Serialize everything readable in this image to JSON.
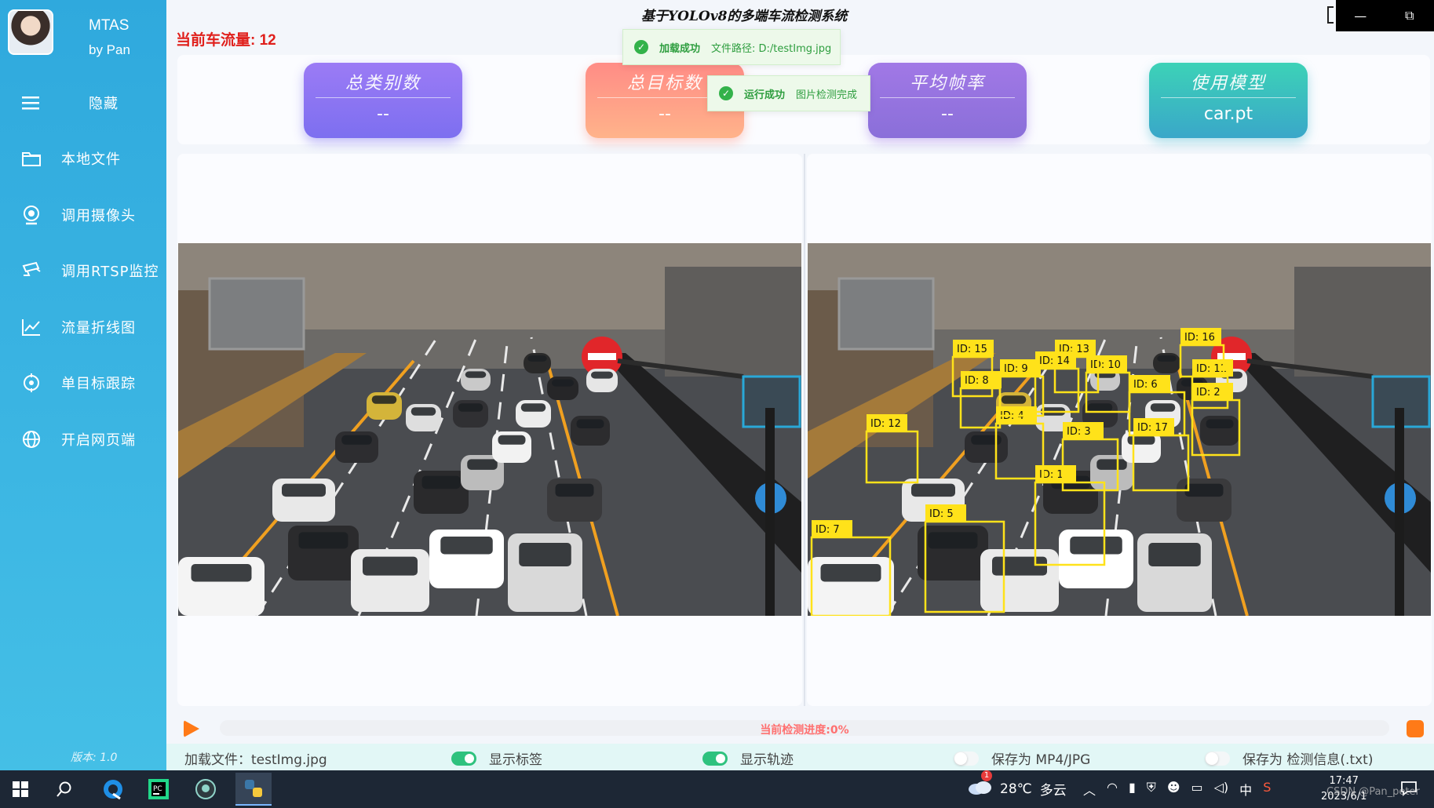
{
  "brand": {
    "title": "MTAS",
    "subtitle": "by Pan"
  },
  "sidebar": {
    "items": [
      {
        "label": "隐藏",
        "icon": "menu-icon"
      },
      {
        "label": "本地文件",
        "icon": "folder-icon"
      },
      {
        "label": "调用摄像头",
        "icon": "webcam-icon"
      },
      {
        "label": "调用RTSP监控",
        "icon": "cctv-icon"
      },
      {
        "label": "流量折线图",
        "icon": "line-chart-icon"
      },
      {
        "label": "单目标跟踪",
        "icon": "target-icon"
      },
      {
        "label": "开启网页端",
        "icon": "globe-icon"
      }
    ],
    "version": "版本: 1.0"
  },
  "window": {
    "title": "基于YOLOv8的多端车流检测系统",
    "minimize": "—",
    "maximize": "⧉"
  },
  "status": {
    "flow": "当前车流量: 12"
  },
  "stats": [
    {
      "title": "总类别数",
      "value": "--"
    },
    {
      "title": "总目标数",
      "value": "--"
    },
    {
      "title": "平均帧率",
      "value": "--"
    },
    {
      "title": "使用模型",
      "value": "car.pt"
    }
  ],
  "toasts": [
    {
      "title": "加载成功",
      "message": "文件路径: D:/testImg.jpg"
    },
    {
      "title": "运行成功",
      "message": "图片检测完成"
    }
  ],
  "detections": [
    {
      "label": "ID: 1"
    },
    {
      "label": "ID: 2"
    },
    {
      "label": "ID: 3"
    },
    {
      "label": "ID: 4"
    },
    {
      "label": "ID: 5"
    },
    {
      "label": "ID: 6"
    },
    {
      "label": "ID: 7"
    },
    {
      "label": "ID: 8"
    },
    {
      "label": "ID: 9"
    },
    {
      "label": "ID: 10"
    },
    {
      "label": "ID: 11"
    },
    {
      "label": "ID: 12"
    },
    {
      "label": "ID: 13"
    },
    {
      "label": "ID: 14"
    },
    {
      "label": "ID: 15"
    },
    {
      "label": "ID: 16"
    },
    {
      "label": "ID: 17"
    }
  ],
  "progress": {
    "text": "当前检测进度:0%",
    "value": 0
  },
  "bottom": {
    "file": "加载文件：testImg.jpg",
    "show_labels": {
      "label": "显示标签",
      "on": true
    },
    "show_tracks": {
      "label": "显示轨迹",
      "on": true
    },
    "save_media": {
      "label": "保存为 MP4/JPG",
      "on": false
    },
    "save_txt": {
      "label": "保存为 检测信息(.txt)",
      "on": false
    }
  },
  "taskbar": {
    "weather_temp": "28℃",
    "weather_desc": "多云",
    "weather_badge": "1",
    "ime": "中",
    "time": "17:47",
    "date": "2023/6/1",
    "watermark": "CSDN @Pan_peter"
  },
  "colors": {
    "sidebar": "#3cb6e3",
    "accent": "#ff7a17",
    "flow_red": "#e0201c",
    "box_yellow": "#ffe21a"
  }
}
